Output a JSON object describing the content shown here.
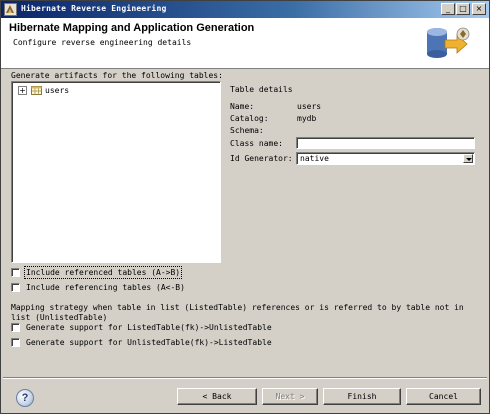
{
  "window": {
    "title": "Hibernate Reverse Engineering",
    "controls": {
      "minimize": "_",
      "maximize": "□",
      "close": "×"
    }
  },
  "banner": {
    "title": "Hibernate Mapping and Application Generation",
    "description": "Configure reverse engineering details"
  },
  "tables_section": {
    "label": "Generate artifacts for the following tables:",
    "tree": [
      {
        "expander": "+",
        "label": "users"
      }
    ]
  },
  "details": {
    "title": "Table details",
    "name_label": "Name:",
    "name_value": "users",
    "catalog_label": "Catalog:",
    "catalog_value": "mydb",
    "schema_label": "Schema:",
    "schema_value": "",
    "class_name_label": "Class name:",
    "class_name_value": "",
    "id_generator_label": "Id Generator:",
    "id_generator_value": "native"
  },
  "options": {
    "include_referenced": "Include referenced tables (A->B)",
    "include_referencing": "Include referencing tables (A<-B)"
  },
  "mapping": {
    "strategy_text": "Mapping strategy when table in list (ListedTable) references or is referred to by table not in list (UnlistedTable)",
    "listed_to_unlisted": "Generate support for ListedTable(fk)->UnlistedTable",
    "unlisted_to_listed": "Generate support for UnlistedTable(fk)->ListedTable"
  },
  "footer": {
    "help": "?",
    "back": "< Back",
    "next": "Next >",
    "finish": "Finish",
    "cancel": "Cancel"
  }
}
